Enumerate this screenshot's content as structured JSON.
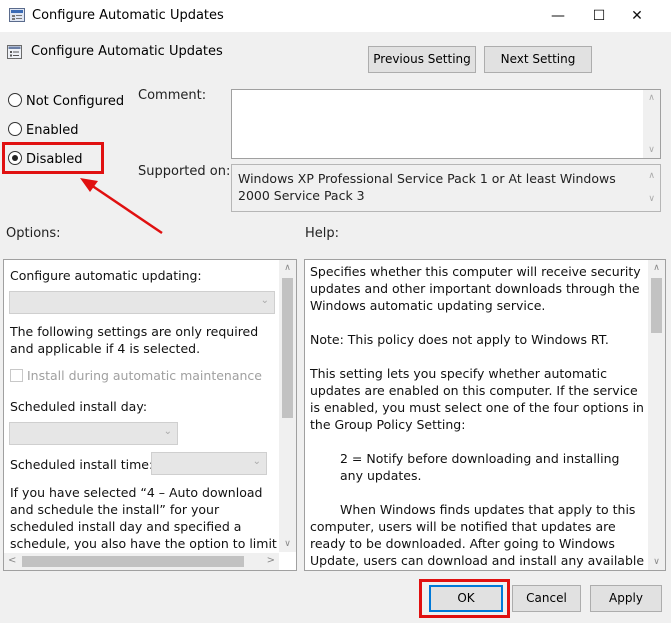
{
  "window": {
    "title": "Configure Automatic Updates",
    "minimize": "—",
    "maximize": "☐",
    "close": "✕"
  },
  "header": {
    "policy_name": "Configure Automatic Updates",
    "previous_label": "Previous Setting",
    "next_label": "Next Setting"
  },
  "state": {
    "not_configured": "Not Configured",
    "enabled": "Enabled",
    "disabled": "Disabled",
    "selected": "disabled"
  },
  "comment_label": "Comment:",
  "supported_label": "Supported on:",
  "supported_value": "Windows XP Professional Service Pack 1 or At least Windows 2000 Service Pack 3",
  "options": {
    "label": "Options:",
    "configure_label": "Configure automatic updating:",
    "note": "The following settings are only required and applicable if 4 is selected.",
    "maintenance_label": "Install during automatic maintenance",
    "day_label": "Scheduled install day:",
    "time_label": "Scheduled install time:",
    "bottom_text": "If you have selected “4 – Auto download and schedule the install” for your scheduled install day and specified a schedule, you also have the option to limit updating to a weekly, bi-weekly"
  },
  "help": {
    "label": "Help:",
    "p1": "Specifies whether this computer will receive security updates and other important downloads through the Windows automatic updating service.",
    "p2": "Note: This policy does not apply to Windows RT.",
    "p3": "This setting lets you specify whether automatic updates are enabled on this computer. If the service is enabled, you must select one of the four options in the Group Policy Setting:",
    "p4": "2 = Notify before downloading and installing any updates.",
    "p5": "When Windows finds updates that apply to this computer, users will be notified that updates are ready to be downloaded. After going to Windows Update, users can download and install any available updates."
  },
  "footer": {
    "ok": "OK",
    "cancel": "Cancel",
    "apply": "Apply"
  },
  "colors": {
    "highlight": "#e01010",
    "focus": "#0078d7"
  }
}
